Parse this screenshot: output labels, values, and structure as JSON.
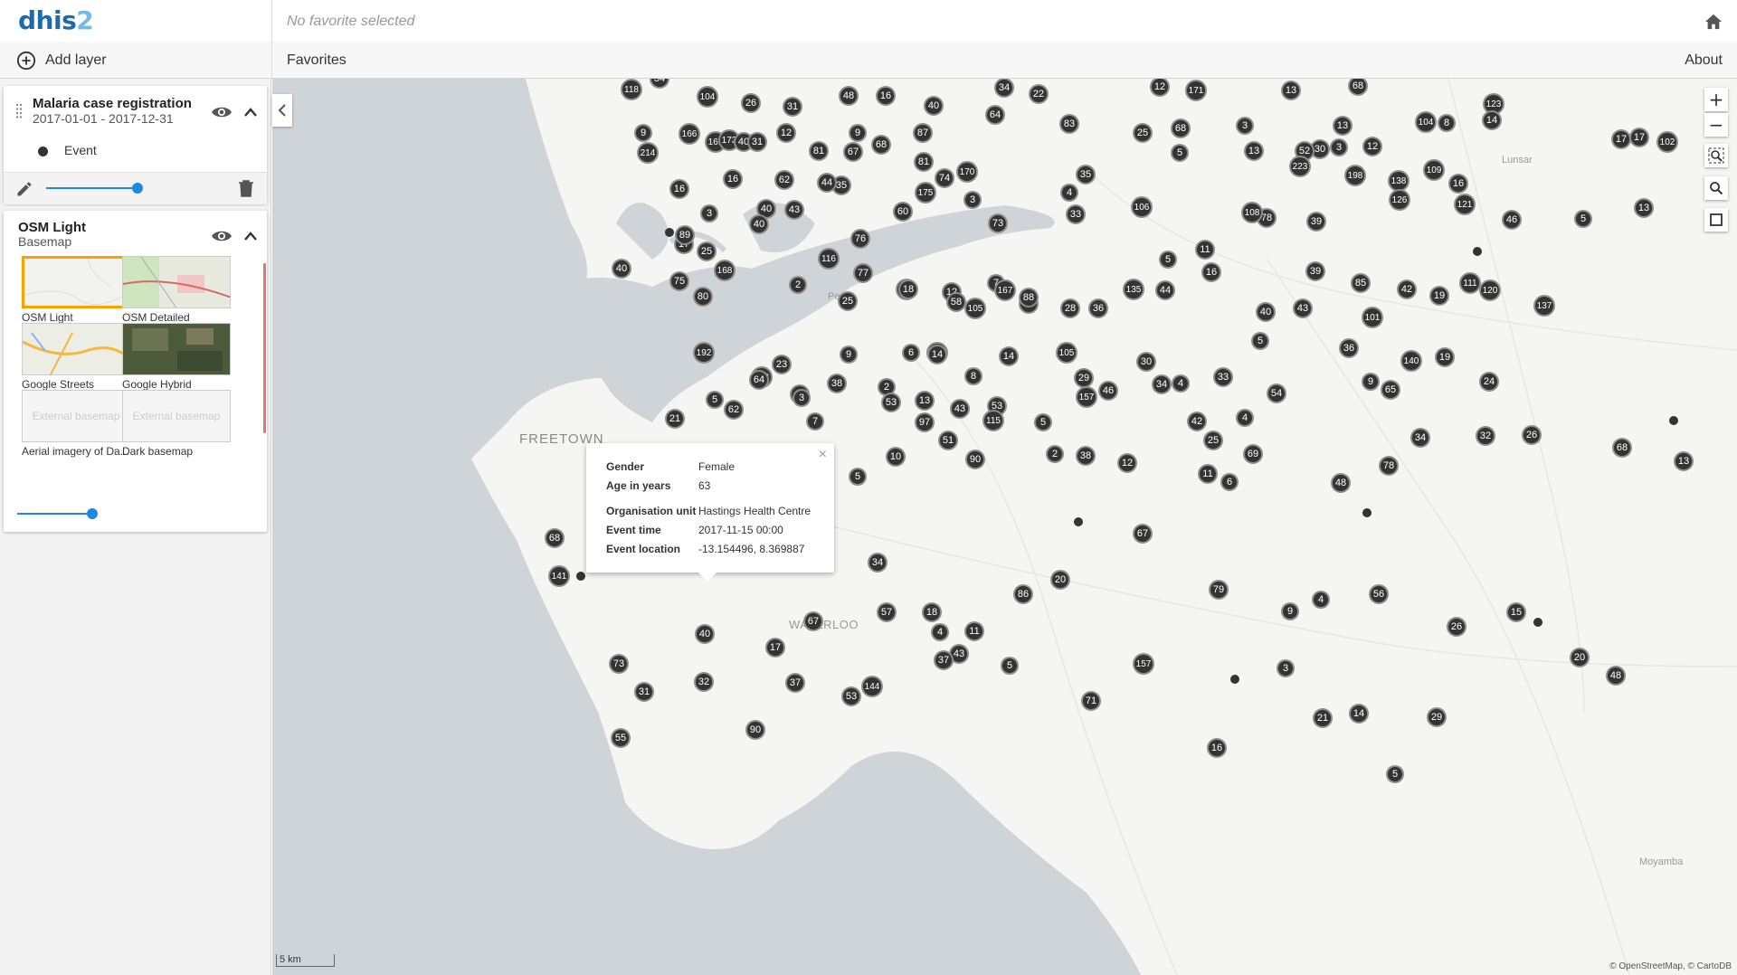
{
  "header": {
    "logo_main": "dhis",
    "logo_num": "2",
    "favorite_title": "No favorite selected"
  },
  "toolbar": {
    "add_layer": "Add layer",
    "favorites": "Favorites",
    "about": "About"
  },
  "layers": [
    {
      "title": "Malaria case registration",
      "subtitle": "2017-01-01 - 2017-12-31",
      "legend": {
        "label": "Event",
        "color": "#333333"
      },
      "opacity": 1.0
    },
    {
      "title": "OSM Light",
      "subtitle": "Basemap",
      "basemaps": [
        {
          "label": "OSM Light",
          "selected": true
        },
        {
          "label": "OSM Detailed",
          "selected": false
        },
        {
          "label": "Google Streets",
          "selected": false
        },
        {
          "label": "Google Hybrid",
          "selected": false
        },
        {
          "label": "Aerial imagery of Da...",
          "selected": false,
          "placeholder": "External basemap"
        },
        {
          "label": "Dark basemap",
          "selected": false,
          "placeholder": "External basemap"
        }
      ],
      "opacity": 1.0
    }
  ],
  "map": {
    "place_labels": [
      "Pepel",
      "FREETOWN",
      "WATERLOO",
      "Lunsar",
      "Moyamba"
    ],
    "cluster_values": [
      118,
      34,
      104,
      26,
      31,
      48,
      16,
      40,
      34,
      22,
      12,
      171,
      13,
      68,
      123,
      9,
      166,
      12,
      9,
      87,
      64,
      83,
      25,
      68,
      3,
      30,
      13,
      12,
      104,
      8,
      14,
      102,
      17,
      17,
      169,
      173,
      40,
      31,
      81,
      68,
      74,
      13,
      52,
      3,
      214,
      16,
      16,
      62,
      67,
      81,
      3,
      73,
      35,
      106,
      5,
      223,
      198,
      138,
      16,
      3,
      40,
      43,
      35,
      60,
      170,
      78,
      39,
      109,
      17,
      40,
      44,
      76,
      175,
      4,
      33,
      108,
      126,
      121,
      46,
      5,
      13,
      40,
      25,
      89,
      168,
      2,
      116,
      77,
      121,
      12,
      7,
      5,
      11,
      39,
      111,
      75,
      80,
      23,
      25,
      18,
      58,
      90,
      105,
      135,
      44,
      16,
      40,
      43,
      85,
      42,
      19,
      120,
      137,
      192,
      112,
      45,
      9,
      6,
      178,
      105,
      167,
      88,
      28,
      36,
      30,
      34,
      33,
      5,
      101,
      65,
      140,
      19,
      62,
      64,
      38,
      2,
      13,
      14,
      8,
      14,
      29,
      157,
      46,
      4,
      54,
      36,
      9,
      24,
      21,
      5,
      3,
      53,
      97,
      43,
      53,
      5,
      42,
      4,
      19,
      7,
      5,
      10,
      51,
      90,
      115,
      2,
      38,
      12,
      25,
      6,
      69,
      34,
      32,
      26,
      68,
      13,
      162,
      69,
      54,
      67,
      34,
      57,
      18,
      11,
      86,
      20,
      79,
      9,
      4,
      56,
      26,
      15,
      20,
      48,
      68,
      141,
      32,
      31,
      17,
      53,
      4,
      43,
      67,
      11,
      48,
      78,
      73,
      55,
      40,
      90,
      37,
      144,
      37,
      5,
      71,
      157,
      16,
      3,
      21,
      14,
      5,
      29
    ],
    "popup": {
      "rows": [
        {
          "key": "Gender",
          "value": "Female"
        },
        {
          "key": "Age in years",
          "value": "63"
        },
        {
          "key": "Organisation unit",
          "value": "Hastings Health Centre"
        },
        {
          "key": "Event time",
          "value": "2017-11-15 00:00"
        },
        {
          "key": "Event location",
          "value": "-13.154496, 8.369887"
        }
      ]
    },
    "scale": "5 km",
    "attribution": "© OpenStreetMap, © CartoDB"
  },
  "colors": {
    "brand": "#1d6aad",
    "cluster": "#333333",
    "water": "#cfd4d8",
    "land": "#f5f5f3",
    "slider": "#1e88e5",
    "selected_basemap": "#ffa000"
  }
}
